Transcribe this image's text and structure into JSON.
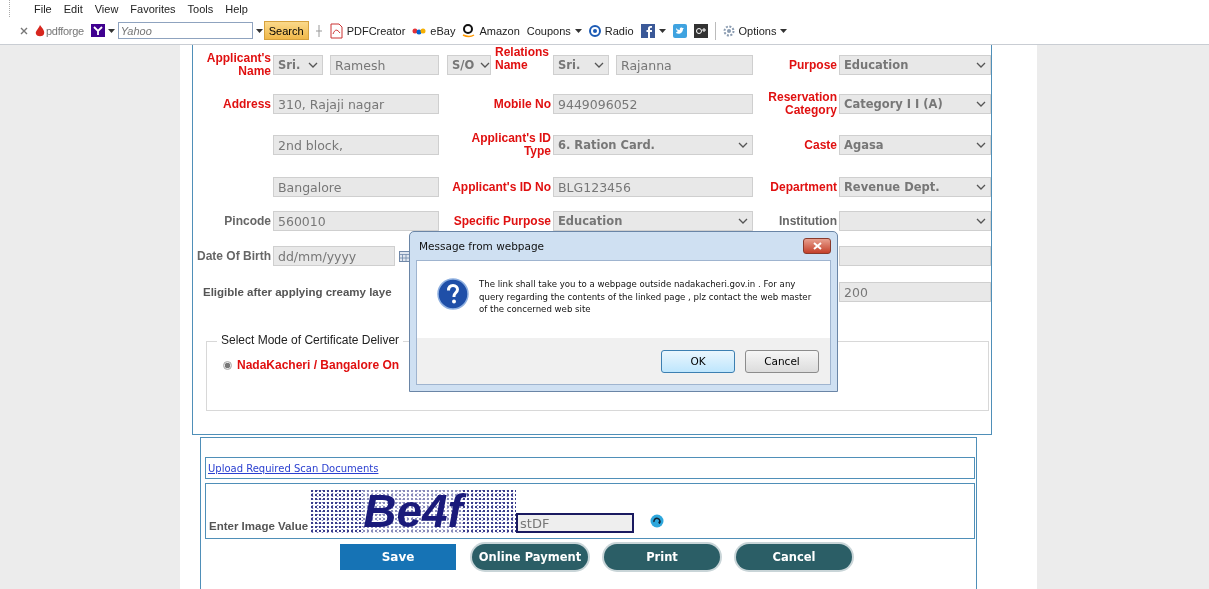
{
  "menu_bar": [
    "File",
    "Edit",
    "View",
    "Favorites",
    "Tools",
    "Help"
  ],
  "toolbar": {
    "logo": "pdfforge",
    "search": {
      "placeholder": "Yahoo",
      "button": "Search"
    },
    "items": [
      {
        "kind": "pdf",
        "label": "PDFCreator"
      },
      {
        "kind": "ebay",
        "label": "eBay"
      },
      {
        "kind": "amazon",
        "label": "Amazon"
      },
      {
        "kind": "menu",
        "label": "Coupons"
      },
      {
        "kind": "radio",
        "label": "Radio"
      },
      {
        "kind": "facebook"
      },
      {
        "kind": "twitter"
      },
      {
        "kind": "gplus"
      },
      {
        "kind": "options",
        "label": "Options"
      }
    ]
  },
  "form": {
    "rows": [
      {
        "c0": [
          {
            "kind": "label",
            "text": "Applicant's Name",
            "required": true
          }
        ],
        "c1": [
          {
            "kind": "select",
            "value": "Sri."
          },
          {
            "kind": "input",
            "value": "Ramesh"
          }
        ],
        "c2": [
          {
            "kind": "select",
            "value": "S/O"
          },
          {
            "kind": "label",
            "text": "Relations Name",
            "required": true
          }
        ],
        "c3": [
          {
            "kind": "select",
            "value": "Sri."
          },
          {
            "kind": "input",
            "value": "Rajanna"
          }
        ],
        "c4": [
          {
            "kind": "label",
            "text": "Purpose",
            "required": true
          }
        ],
        "c5": [
          {
            "kind": "select",
            "value": "Education"
          }
        ]
      },
      {
        "c0": [
          {
            "kind": "label",
            "text": "Address",
            "required": true
          }
        ],
        "c1": [
          {
            "kind": "input",
            "value": "310, Rajaji nagar"
          }
        ],
        "c2": [
          {
            "kind": "label",
            "text": "Mobile No",
            "required": true
          }
        ],
        "c3": [
          {
            "kind": "input",
            "value": "9449096052"
          }
        ],
        "c4": [
          {
            "kind": "label",
            "text": "Reservation Category",
            "required": true
          }
        ],
        "c5": [
          {
            "kind": "select",
            "value": "Category I I (A)"
          }
        ]
      },
      {
        "c1": [
          {
            "kind": "input",
            "value": "2nd block,"
          }
        ],
        "c2": [
          {
            "kind": "label",
            "text": "Applicant's ID Type",
            "required": true
          }
        ],
        "c3": [
          {
            "kind": "select",
            "value": "6. Ration Card."
          }
        ],
        "c4": [
          {
            "kind": "label",
            "text": "Caste",
            "required": true
          }
        ],
        "c5": [
          {
            "kind": "select",
            "value": "Agasa"
          }
        ]
      },
      {
        "c1": [
          {
            "kind": "input",
            "value": "Bangalore"
          }
        ],
        "c2": [
          {
            "kind": "label",
            "text": "Applicant's ID No",
            "required": true
          }
        ],
        "c3": [
          {
            "kind": "input",
            "value": "BLG123456"
          }
        ],
        "c4": [
          {
            "kind": "label",
            "text": "Department",
            "required": true
          }
        ],
        "c5": [
          {
            "kind": "select",
            "value": "Revenue Dept."
          }
        ]
      },
      {
        "c0": [
          {
            "kind": "label",
            "text": "Pincode",
            "required": false
          }
        ],
        "c1": [
          {
            "kind": "input",
            "value": "560010"
          }
        ],
        "c2": [
          {
            "kind": "label",
            "text": "Specific Purpose",
            "required": true
          }
        ],
        "c3": [
          {
            "kind": "select",
            "value": "Education"
          }
        ],
        "c4": [
          {
            "kind": "label",
            "text": "Institution",
            "required": false
          }
        ],
        "c5": [
          {
            "kind": "select"
          }
        ]
      },
      {
        "c0": [
          {
            "kind": "label",
            "text": "Date Of Birth",
            "required": false
          }
        ],
        "c1": [
          {
            "kind": "date",
            "placeholder": "dd/mm/yyyy"
          }
        ],
        "c5": [
          {
            "kind": "input"
          }
        ]
      },
      {
        "c0": [
          {
            "kind": "note",
            "text": "Eligible after applying creamy laye"
          }
        ],
        "c5": [
          {
            "kind": "input",
            "value": "200"
          }
        ]
      }
    ]
  },
  "delivery": {
    "legend": "Select Mode of Certificate Deliver",
    "options": [
      {
        "label": "NadaKacheri / Bangalore On",
        "selected": true
      }
    ]
  },
  "uploads": {
    "link": "Upload Required Scan Documents"
  },
  "captcha": {
    "label": "Enter Image Value",
    "image_text": "Be4f",
    "value": "stDF"
  },
  "buttons": [
    {
      "label": "Save",
      "kind": "primary"
    },
    {
      "label": "Online Payment",
      "kind": "pill"
    },
    {
      "label": "Print",
      "kind": "pill"
    },
    {
      "label": "Cancel",
      "kind": "pill"
    }
  ],
  "dialog": {
    "title": "Message from webpage",
    "message": "The link shall take you to a webpage outside nadakacheri.gov.in . For any query regarding the contents of the linked page , plz contact the web master of the concerned web site",
    "buttons": [
      {
        "label": "OK",
        "focused": true
      },
      {
        "label": "Cancel",
        "focused": false
      }
    ]
  }
}
